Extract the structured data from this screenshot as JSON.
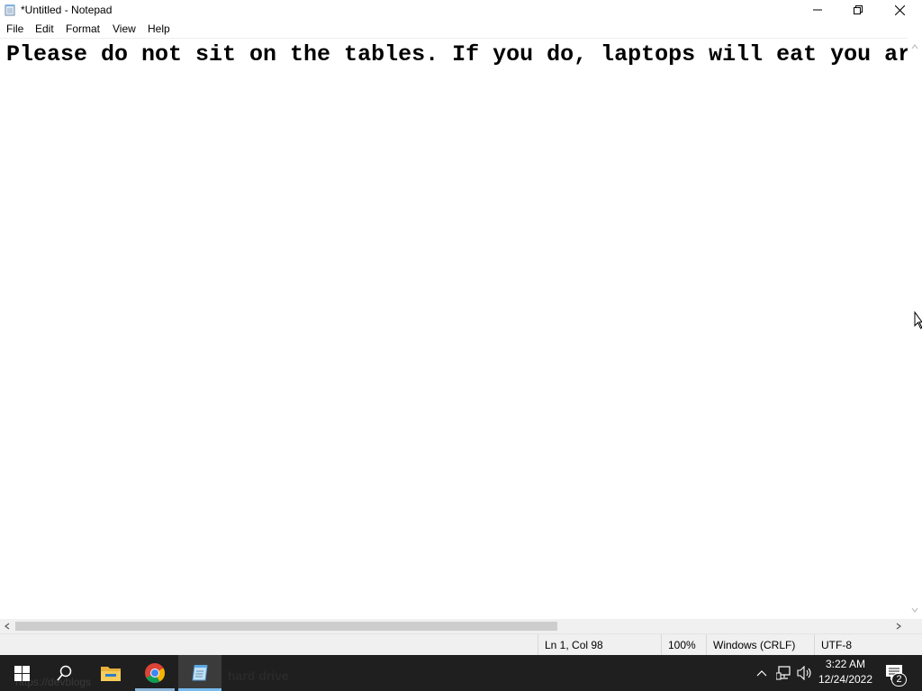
{
  "window": {
    "title": "*Untitled - Notepad"
  },
  "menu": {
    "items": [
      "File",
      "Edit",
      "Format",
      "View",
      "Help"
    ]
  },
  "editor": {
    "content": "Please do not sit on the tables. If you do, laptops will eat you ar"
  },
  "statusbar": {
    "position": "Ln 1, Col 98",
    "zoom": "100%",
    "line_ending": "Windows (CRLF)",
    "encoding": "UTF-8"
  },
  "taskbar": {
    "ghost_title": "hard drive",
    "ghost_url": "https://devblogs",
    "clock_time": "3:22 AM",
    "clock_date": "12/24/2022",
    "notification_count": "2"
  },
  "colors": {
    "taskbar_bg": "#1f1f1f",
    "active_indicator": "#76b9ed",
    "scroll_thumb": "#cdcdcd",
    "status_bg": "#f0f0f0"
  },
  "icons": {
    "app": "notepad-icon",
    "minimize": "minimize-icon",
    "maximize": "restore-icon",
    "close": "close-icon",
    "start": "windows-logo-icon",
    "search": "search-icon",
    "explorer": "folder-icon",
    "chrome": "chrome-icon",
    "notepad": "notepad-icon",
    "tray": [
      "chevron-up-icon",
      "network-icon",
      "volume-icon",
      "notification-icon"
    ]
  }
}
